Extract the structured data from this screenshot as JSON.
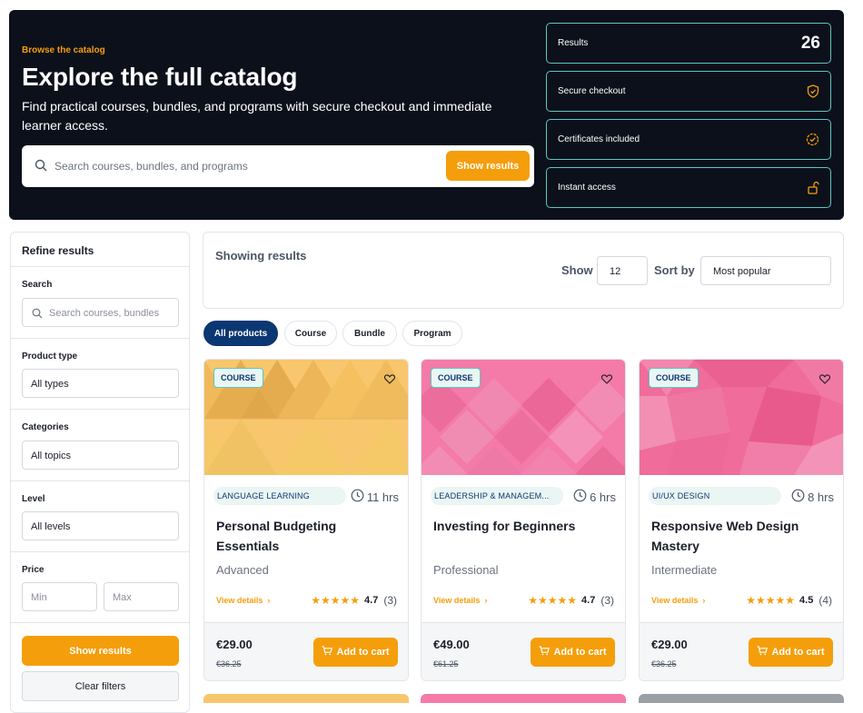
{
  "hero": {
    "eyebrow": "Browse the catalog",
    "title": "Explore the full catalog",
    "description": "Find practical courses, bundles, and programs with secure checkout and immediate learner access.",
    "search_placeholder": "Search courses, bundles, and programs",
    "search_button": "Show results"
  },
  "stats": [
    {
      "label": "Results",
      "value": "26"
    },
    {
      "label": "Secure checkout",
      "icon": "shield-icon"
    },
    {
      "label": "Certificates included",
      "icon": "badge-check-icon"
    },
    {
      "label": "Instant access",
      "icon": "unlock-icon"
    }
  ],
  "sidebar": {
    "title": "Refine results",
    "search_label": "Search",
    "search_placeholder": "Search courses, bundles",
    "product_type_label": "Product type",
    "product_type_value": "All types",
    "categories_label": "Categories",
    "categories_value": "All topics",
    "level_label": "Level",
    "level_value": "All levels",
    "price_label": "Price",
    "min_placeholder": "Min",
    "max_placeholder": "Max",
    "apply_button": "Show results",
    "clear_button": "Clear filters"
  },
  "toolbar": {
    "heading": "Showing results",
    "show_label": "Show",
    "show_value": "12",
    "sort_label": "Sort by",
    "sort_value": "Most popular"
  },
  "filters": [
    "All products",
    "Course",
    "Bundle",
    "Program"
  ],
  "cards": [
    {
      "badge": "COURSE",
      "category": "LANGUAGE LEARNING",
      "hours": "11 hrs",
      "title": "Personal Budgeting Essentials",
      "level": "Advanced",
      "view": "View details",
      "rating": "4.7",
      "count": "(3)",
      "price": "€29.00",
      "old_price": "€36.25",
      "cart": "Add to cart"
    },
    {
      "badge": "COURSE",
      "category": "LEADERSHIP & MANAGEM...",
      "hours": "6 hrs",
      "title": "Investing for Beginners",
      "level": "Professional",
      "view": "View details",
      "rating": "4.7",
      "count": "(3)",
      "price": "€49.00",
      "old_price": "€61.25",
      "cart": "Add to cart"
    },
    {
      "badge": "COURSE",
      "category": "UI/UX DESIGN",
      "hours": "8 hrs",
      "title": "Responsive Web Design Mastery",
      "level": "Intermediate",
      "view": "View details",
      "rating": "4.5",
      "count": "(4)",
      "price": "€29.00",
      "old_price": "€36.25",
      "cart": "Add to cart"
    }
  ],
  "colors": {
    "accent": "#f59e0b",
    "navy": "#0b3773",
    "hero_bg": "#0b101b",
    "teal": "#5ac8c0"
  }
}
